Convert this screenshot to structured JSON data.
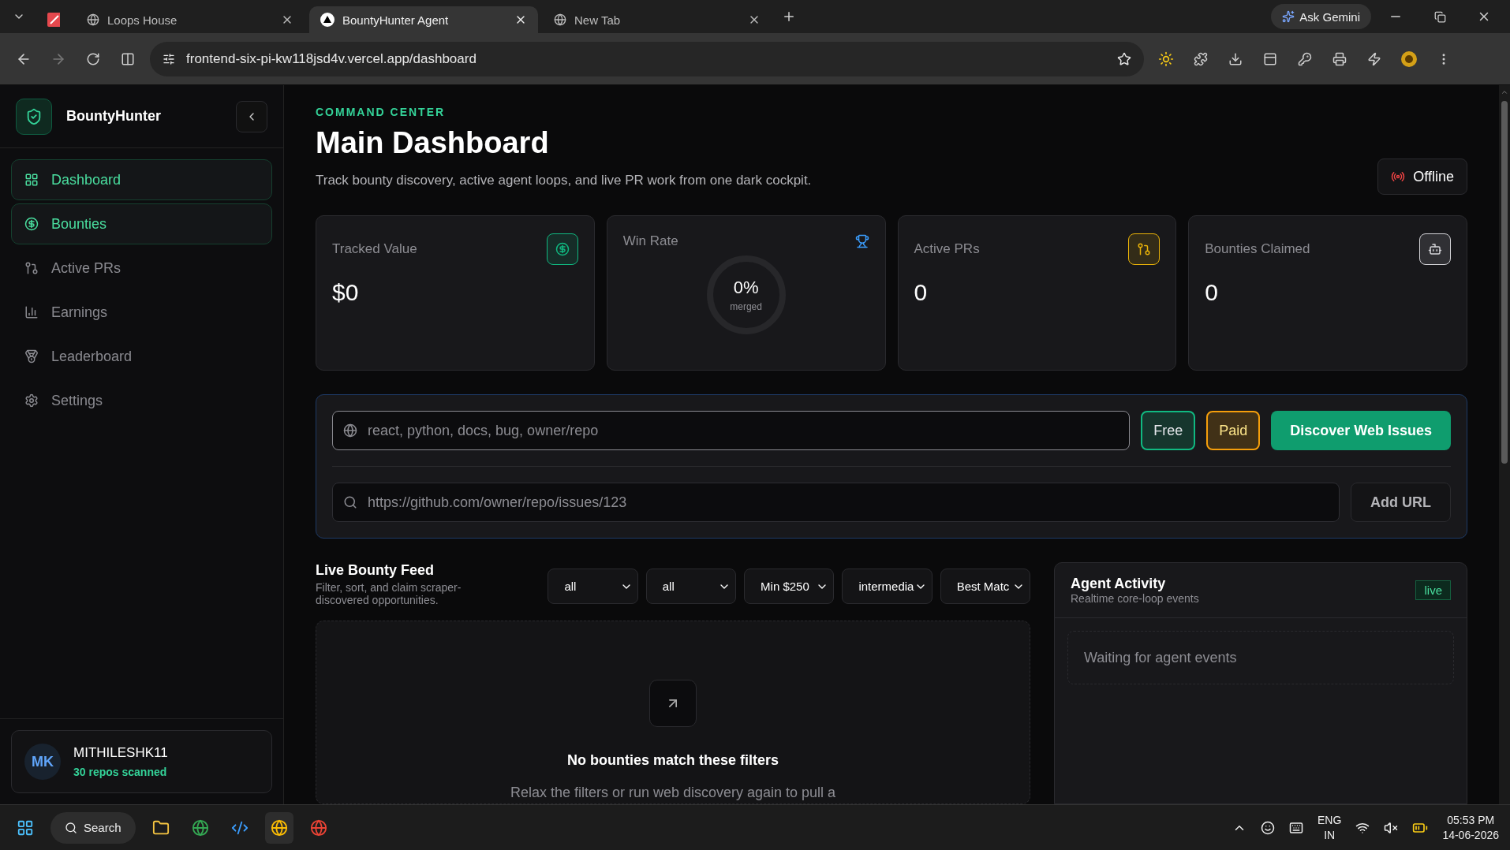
{
  "browser": {
    "tabs": [
      {
        "selected": false,
        "kind": "pinned"
      },
      {
        "title": "Loops House",
        "selected": false,
        "kind": "page"
      },
      {
        "title": "BountyHunter Agent",
        "selected": true,
        "kind": "page"
      },
      {
        "title": "New Tab",
        "selected": false,
        "kind": "page"
      }
    ],
    "ask_gemini": "Ask Gemini",
    "url": "frontend-six-pi-kw118jsd4v.vercel.app/dashboard"
  },
  "sidebar": {
    "brand": "BountyHunter",
    "nav": [
      {
        "label": "Dashboard",
        "selected": true
      },
      {
        "label": "Bounties",
        "selected": true
      },
      {
        "label": "Active PRs",
        "selected": false
      },
      {
        "label": "Earnings",
        "selected": false
      },
      {
        "label": "Leaderboard",
        "selected": false
      },
      {
        "label": "Settings",
        "selected": false
      }
    ],
    "user": {
      "initials": "MK",
      "name": "MITHILESHK11",
      "subtitle": "30 repos scanned"
    }
  },
  "header": {
    "eyebrow": "COMMAND CENTER",
    "title": "Main Dashboard",
    "description": "Track bounty discovery, active agent loops, and live PR work from one dark cockpit.",
    "status": "Offline"
  },
  "stats": [
    {
      "kind": "value",
      "label": "Tracked Value",
      "value": "$0",
      "color": "#10b981"
    },
    {
      "kind": "ring",
      "label": "Win Rate",
      "value": "0%",
      "caption": "merged",
      "color": "#3b9eff"
    },
    {
      "kind": "value",
      "label": "Active PRs",
      "value": "0",
      "color": "#eab308"
    },
    {
      "kind": "value",
      "label": "Bounties Claimed",
      "value": "0",
      "color": "#d4d4d8"
    }
  ],
  "discover": {
    "placeholder": "react, python, docs, bug, owner/repo",
    "toggles": [
      {
        "label": "Free",
        "selected": true,
        "color": "#10b981"
      },
      {
        "label": "Paid",
        "selected": true,
        "color": "#f59e0b"
      }
    ],
    "button": "Discover Web Issues",
    "url_placeholder": "https://github.com/owner/repo/issues/123",
    "add_button": "Add URL"
  },
  "feed": {
    "title": "Live Bounty Feed",
    "subtitle": "Filter, sort, and claim scraper-discovered opportunities.",
    "filters": [
      "all",
      "all",
      "Min $250",
      "intermedia",
      "Best Matc"
    ],
    "empty_title": "No bounties match these filters",
    "empty_text": "Relax the filters or run web discovery again to pull a"
  },
  "activity": {
    "title": "Agent Activity",
    "subtitle": "Realtime core-loop events",
    "badge": "live",
    "empty": "Waiting for agent events"
  },
  "taskbar": {
    "search": "Search",
    "language": "ENG",
    "region": "IN",
    "time": "05:53 PM",
    "date": "14-06-2026"
  }
}
